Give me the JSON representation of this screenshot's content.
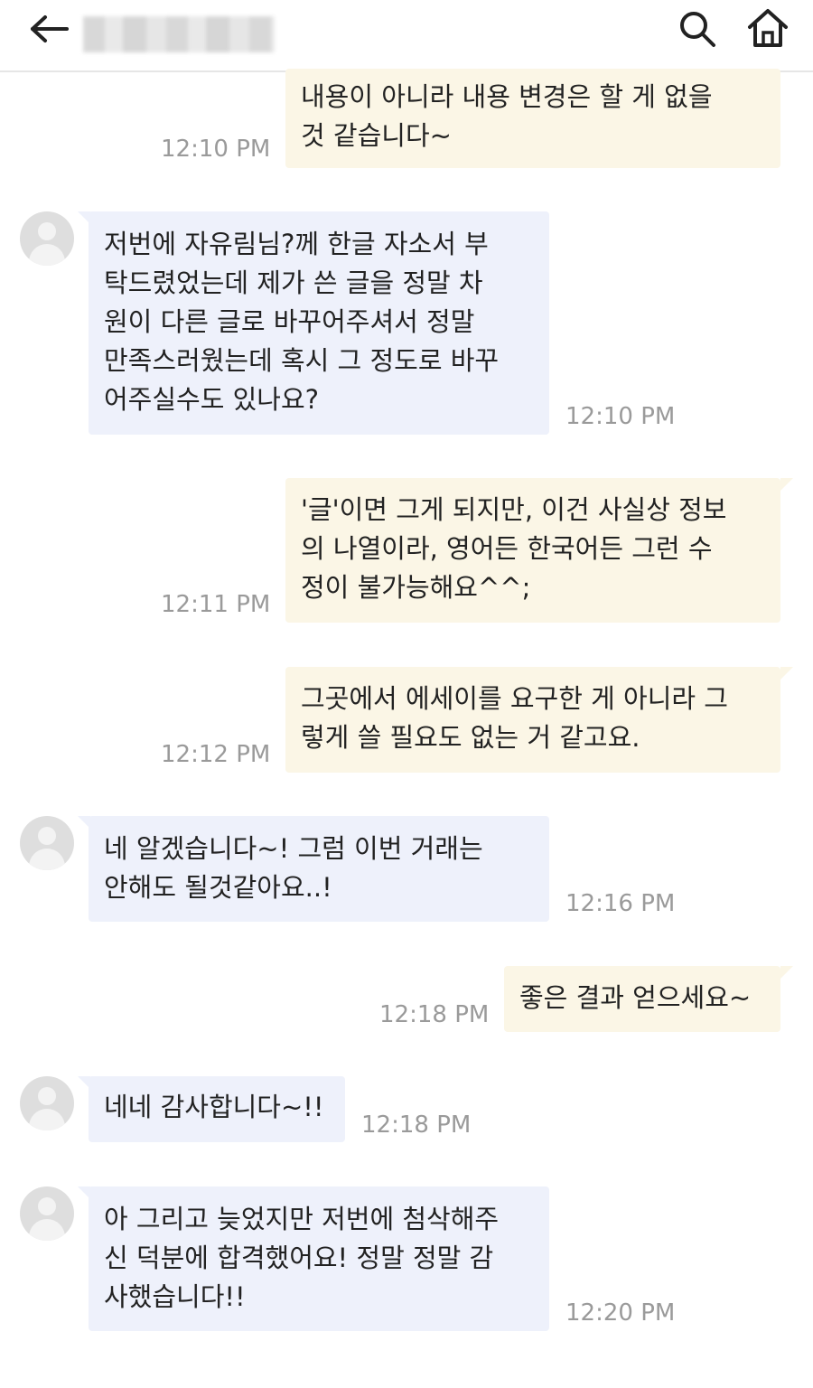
{
  "header": {
    "title_redacted": true
  },
  "messages": [
    {
      "side": "me",
      "text": "내용이 아니라 내용 변경은 할 게 없을\n것 같습니다~",
      "time": "12:10 PM"
    },
    {
      "side": "them",
      "text": "저번에 자유림님?께 한글 자소서 부\n탁드렸었는데 제가 쓴 글을 정말 차\n원이 다른 글로 바꾸어주셔서 정말\n만족스러웠는데 혹시 그 정도로 바꾸\n어주실수도 있나요?",
      "time": "12:10 PM"
    },
    {
      "side": "me",
      "text": "'글'이면 그게 되지만, 이건 사실상 정보\n의 나열이라, 영어든 한국어든 그런 수\n정이 불가능해요^^;",
      "time": "12:11 PM"
    },
    {
      "side": "me",
      "text": "그곳에서 에세이를 요구한 게 아니라 그\n렇게 쓸 필요도 없는 거 같고요.",
      "time": "12:12 PM"
    },
    {
      "side": "them",
      "text": "네 알겠습니다~! 그럼 이번 거래는\n안해도 될것같아요..!",
      "time": "12:16 PM"
    },
    {
      "side": "me",
      "text": "좋은 결과 얻으세요~",
      "time": "12:18 PM"
    },
    {
      "side": "them",
      "text": "네네 감사합니다~!!",
      "time": "12:18 PM"
    },
    {
      "side": "them",
      "text": "아 그리고 늦었지만 저번에 첨삭해주\n신 덕분에 합격했어요! 정말 정말 감\n사했습니다!!",
      "time": "12:20 PM"
    }
  ],
  "colors": {
    "my_bubble": "#fbf6e6",
    "their_bubble": "#eef1fb",
    "timestamp": "#9a9a9a",
    "avatar": "#dedede"
  },
  "icons": [
    "back-arrow-icon",
    "search-icon",
    "home-icon",
    "avatar-icon"
  ]
}
